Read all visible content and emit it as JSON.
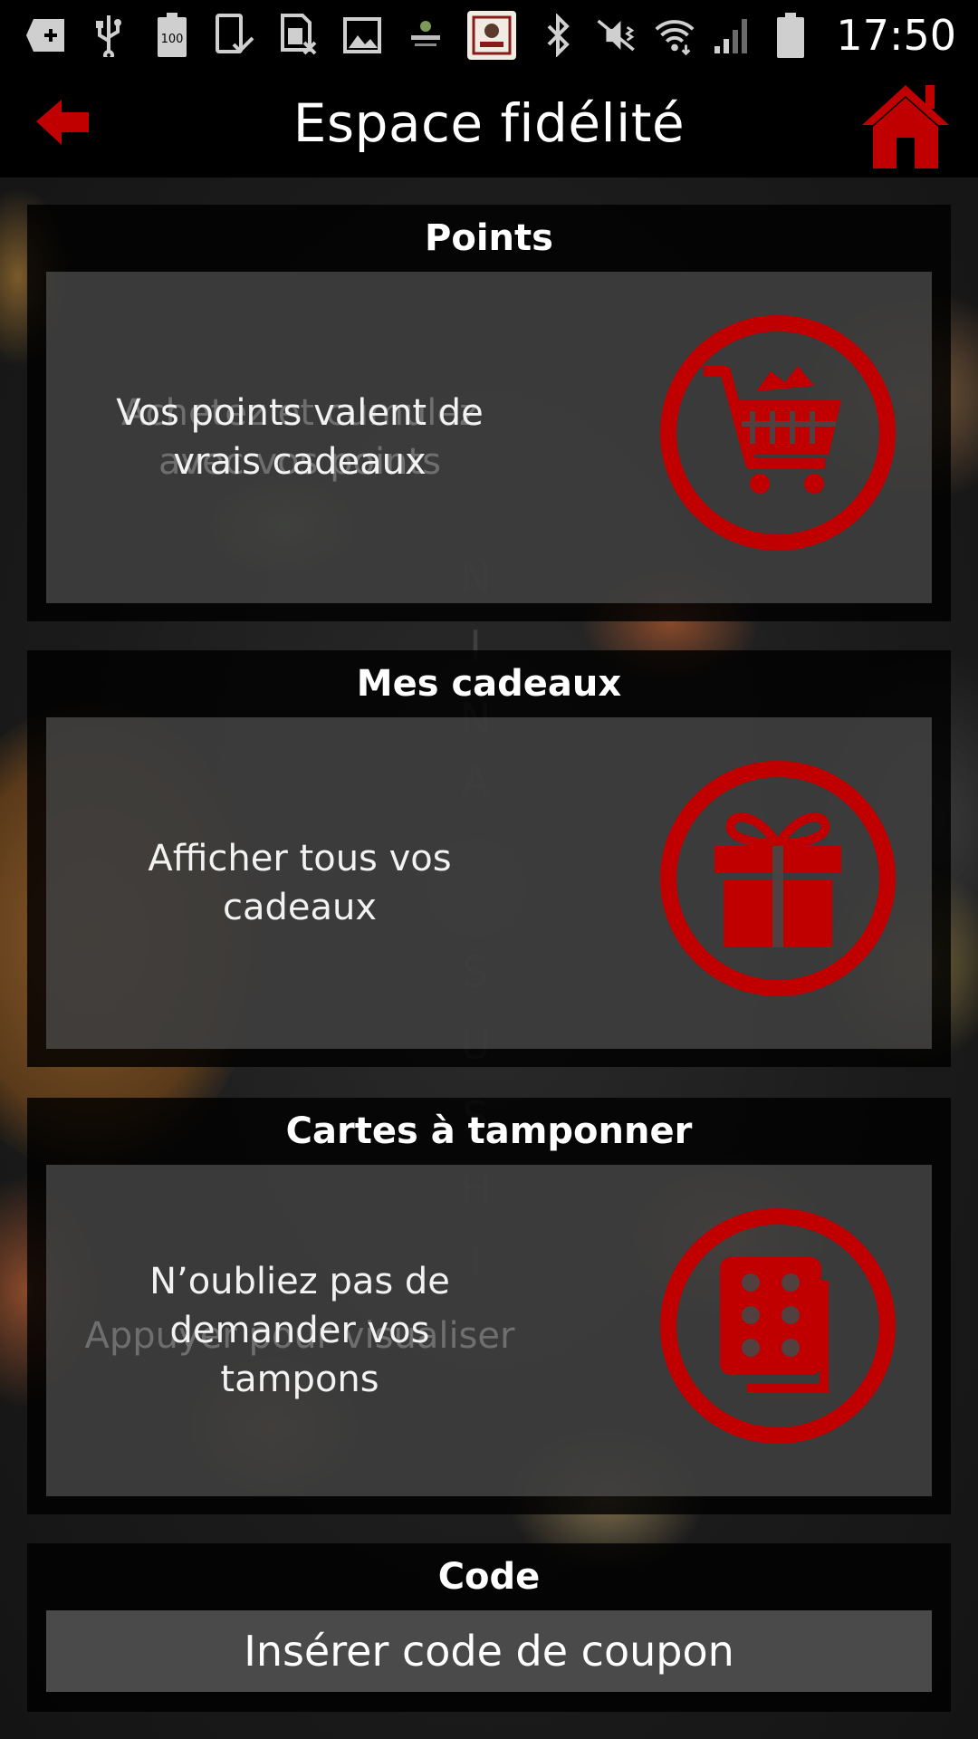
{
  "status_bar": {
    "time": "17:50",
    "battery_label": "100",
    "icons": [
      "add-box-icon",
      "usb-icon",
      "battery-100-icon",
      "tablet-check-icon",
      "sim-off-icon",
      "image-icon",
      "sortis-logo-icon",
      "restaurant-logo-icon",
      "bluetooth-icon",
      "mute-vibrate-icon",
      "wifi-icon",
      "signal-icon",
      "battery-icon"
    ]
  },
  "header": {
    "title": "Espace fidélité",
    "back_icon": "arrow-left-icon",
    "home_icon": "home-icon"
  },
  "background": {
    "brand_letters": [
      "N",
      "I",
      "N",
      "A",
      "S",
      "U",
      "S",
      "H",
      "I"
    ]
  },
  "sections": {
    "points": {
      "title": "Points",
      "text": "Vos points valent de vrais cadeaux",
      "ghost_text": "Achetez et cumulez avec vos points",
      "icon": "cart-icon"
    },
    "gifts": {
      "title": "Mes cadeaux",
      "text": "Afficher tous vos cadeaux",
      "icon": "gift-icon"
    },
    "stamps": {
      "title": "Cartes à tamponner",
      "text": "N’oubliez pas de demander vos tampons",
      "ghost_text": "Appuyer pour visualiser",
      "icon": "stamp-card-icon"
    },
    "code": {
      "title": "Code",
      "placeholder": "Insérer code de coupon"
    }
  },
  "colors": {
    "accent": "#c00000",
    "header_bg": "#000000",
    "card_bg": "#5c5c5c"
  }
}
